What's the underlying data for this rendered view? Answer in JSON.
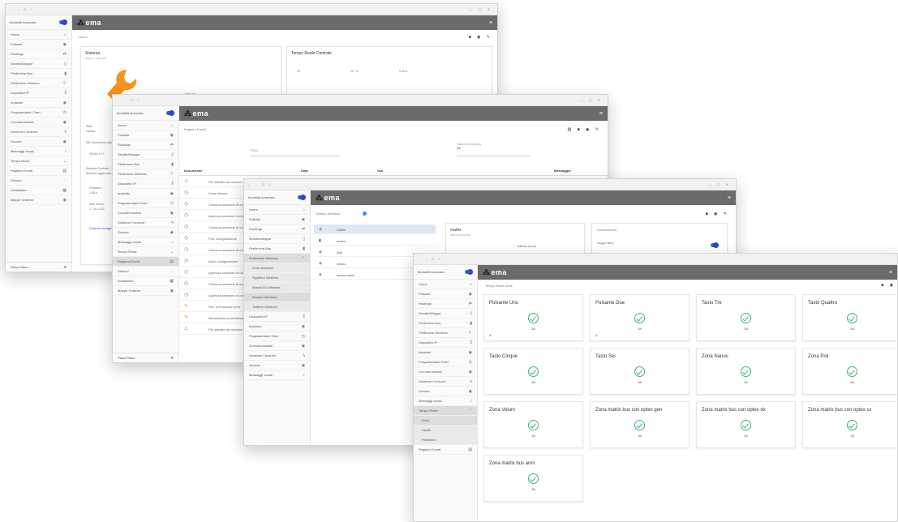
{
  "app": {
    "logo": "ema",
    "logo_mark": "⁂",
    "menu_icon": "hamburger-icon"
  },
  "browser": {
    "nav": "← → C ⌂",
    "controls": "— ▢ ✕"
  },
  "profile": {
    "label": "Modalità Avanzata"
  },
  "nav": {
    "home": "Home",
    "pulsanti": "Pulsanti",
    "routings": "Routings",
    "sinottici": "Sinottici/Mappe",
    "periferiche_bus": "Periferiche Bus",
    "periferiche_wireless": "Periferiche Wireless",
    "dispositivi_ip": "Dispositivi IP",
    "impianto": "Impianto",
    "programmatori": "Programmatori Orari",
    "cronotermostati": "Cronotermostati",
    "gestione_consumi": "Gestione Consumi",
    "scenari": "Scenari",
    "messaggi": "Messaggi vocali",
    "tempo_reale": "Tempo Reale",
    "registro": "Registro Eventi",
    "sensori": "Sensori",
    "installatore": "Installatore",
    "mappa": "Mappe Grafiche",
    "sub_wireless": [
      "Zone Wireless",
      "Ripetitori Wireless",
      "Moduli I/O Wireless",
      "Sensori Wireless",
      "Tastiere Wireless"
    ],
    "sub_tempo": [
      "Zone",
      "Uscite",
      "Partizioni"
    ],
    "footer_label": "Piano Piano"
  },
  "win1": {
    "crumb": "Home",
    "sistema_title": "Sistema",
    "sistema_sub": "WAIT 0.7 0MM 188",
    "tempo_title": "Tempo Reale Centrale",
    "stato_label": "Stato",
    "stato_val": "Inserito",
    "sottoscritti": "8/8 Connessioni attive",
    "version": "0000d: 10.7",
    "software": "Software Centrale",
    "software_sub": "Software aggiornato",
    "fw_label": "Firmware",
    "fw_val": "1.85.9",
    "web_label": "Web Server",
    "web_val": "1.7.8.1.0.00",
    "link": "Gestione Immagini",
    "badge1": "00",
    "badge2": "11.7 A",
    "badge3": "0.00 A",
    "notes": "Manuale"
  },
  "win2": {
    "crumb": "Registro Eventi",
    "filter_label": "Filtra",
    "date_label": "Data selezionata",
    "date_val": "All",
    "col_desc": "Descrizione",
    "col_date": "Data",
    "col_ora": "Ora",
    "col_msg": "Messaggio",
    "events": [
      "Ptt. stabilito da ricevere",
      "Zona allarme",
      "Chiusura sessione di comunicazione",
      "Apertura sessione di comunicazione",
      "Chiusura sessione di comunicazione",
      "Fine configurazione",
      "Chiusura sessione di comunicazione",
      "Inizio configurazione",
      "Apertura sessione di comunicazione",
      "Chiusura sessione di comunicazione",
      "Apertura sessione di comunicazione",
      "Pwr. a rimuovere porti",
      "Manomissione periferica",
      "Ptt. stabilito da ricevere"
    ]
  },
  "win3": {
    "crumb": "Sensori Wireless",
    "devices": [
      "matrix",
      "meteo",
      "pioli",
      "velluto",
      "sensor sotto"
    ],
    "card_title": "matrix",
    "card_sub": "0000 0000 000000",
    "battery": "Batteria buona",
    "zone_label": "Funzionamento",
    "zone_val": "Maggio attivo"
  },
  "win4": {
    "crumb": "Tempo Reale Zone",
    "zones": [
      {
        "name": "Pulsante Uno",
        "count": "38",
        "foot": "A"
      },
      {
        "name": "Pulsante Due",
        "count": "38",
        "foot": "A"
      },
      {
        "name": "Tasto Tre",
        "count": "38",
        "foot": ""
      },
      {
        "name": "Tasto Quattro",
        "count": "38",
        "foot": ""
      },
      {
        "name": "Tasto Cinque",
        "count": "38",
        "foot": ""
      },
      {
        "name": "Tasto Sei",
        "count": "38",
        "foot": ""
      },
      {
        "name": "Zona Nanus",
        "count": "38",
        "foot": ""
      },
      {
        "name": "Zona Poli",
        "count": "38",
        "foot": ""
      },
      {
        "name": "Zona Velum",
        "count": "38",
        "foot": ""
      },
      {
        "name": "Zona matrix bus con optex gen",
        "count": "38",
        "foot": ""
      },
      {
        "name": "Zona matrix bus con optex dx",
        "count": "38",
        "foot": ""
      },
      {
        "name": "Zona matrix bus con optex sx",
        "count": "38",
        "foot": ""
      },
      {
        "name": "Zona matrix bus anni",
        "count": "38",
        "foot": ""
      }
    ]
  },
  "colors": {
    "topbar": "#6b6b6b",
    "accent": "#3b5bdb",
    "ok": "#3cb371",
    "wrench": "#f5941e"
  }
}
